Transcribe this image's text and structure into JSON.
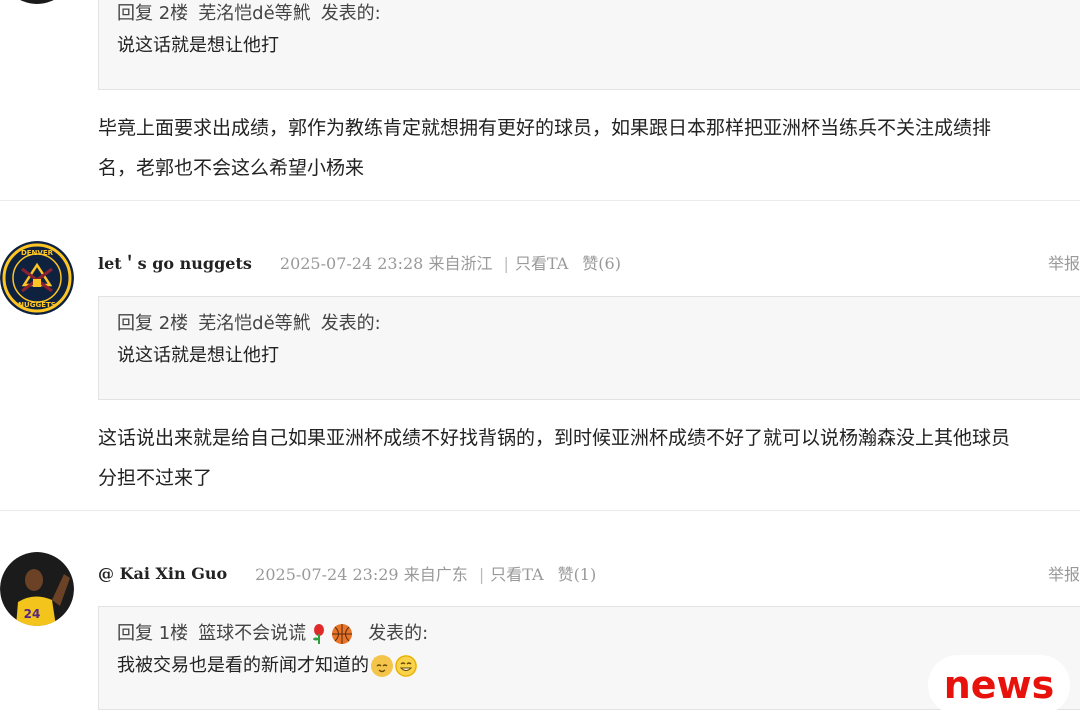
{
  "comments": [
    {
      "quote": {
        "floor": "回复 2楼",
        "user": "芜洺恺dě等鮘",
        "said": "发表的:",
        "text": "说这话就是想让他打"
      },
      "body_line1": "毕竟上面要求出成绩，郭作为教练肯定就想拥有更好的球员，如果跟日本那样把亚洲杯当练兵不关注成绩排",
      "body_line2": "名，老郭也不会这么希望小杨来"
    },
    {
      "username": "let＇s go nuggets",
      "datetime": "2025-07-24 23:28",
      "location": "来自浙江",
      "only_ta": "只看TA",
      "likes": "赞(6)",
      "report": "举报",
      "avatar_text": "DENVER NUGGETS",
      "quote": {
        "floor": "回复 2楼",
        "user": "芜洺恺dě等鮘",
        "said": "发表的:",
        "text": "说这话就是想让他打"
      },
      "body_line1": "这话说出来就是给自己如果亚洲杯成绩不好找背锅的，到时候亚洲杯成绩不好了就可以说杨瀚森没上其他球员",
      "body_line2": "分担不过来了"
    },
    {
      "username": "@ Kai Xin Guo",
      "datetime": "2025-07-24 23:29",
      "location": "来自广东",
      "only_ta": "只看TA",
      "likes": "赞(1)",
      "report": "举报",
      "avatar_text": "24",
      "quote": {
        "floor": "回复 1楼",
        "user": "篮球不会说谎",
        "said": "发表的:",
        "text": "我被交易也是看的新闻才知道的"
      }
    }
  ],
  "watermark": "news",
  "icons": {
    "rose": "rose-icon",
    "basketball": "basketball-icon",
    "cat_face": "cat-face-icon",
    "grin_face": "grinning-face-icon"
  }
}
